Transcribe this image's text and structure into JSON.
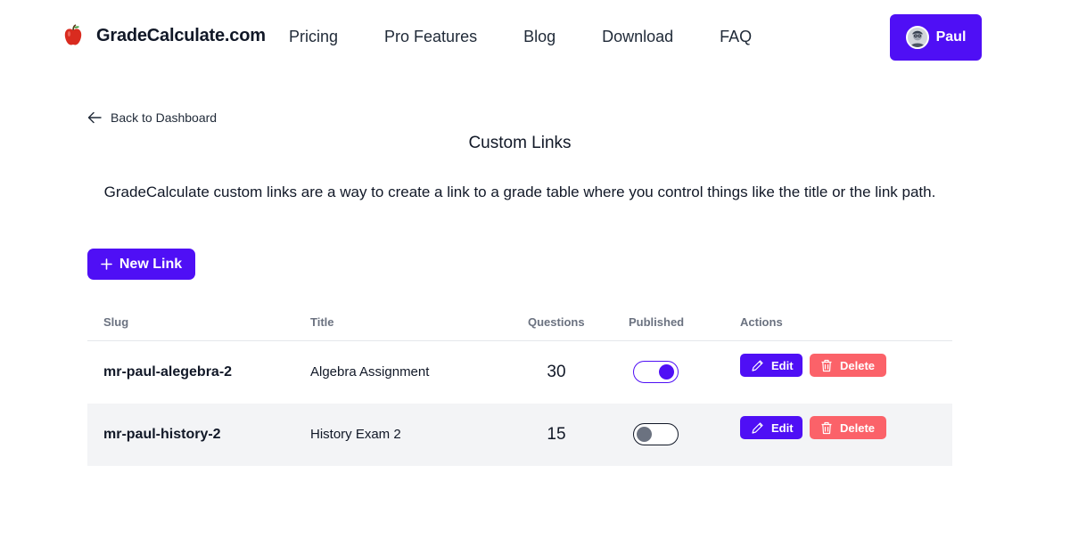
{
  "brand": {
    "name": "GradeCalculate.com",
    "logo_icon": "apple-icon"
  },
  "nav": {
    "items": [
      {
        "label": "Pricing"
      },
      {
        "label": "Pro Features"
      },
      {
        "label": "Blog"
      },
      {
        "label": "Download"
      },
      {
        "label": "FAQ"
      }
    ]
  },
  "user": {
    "name": "Paul"
  },
  "back_link": {
    "label": "Back to Dashboard",
    "icon": "arrow-left-icon"
  },
  "page": {
    "title": "Custom Links",
    "description": "GradeCalculate custom links are a way to create a link to a grade table where you control things like the title or the link path."
  },
  "new_link_button": {
    "label": "New Link",
    "icon": "plus-icon"
  },
  "table": {
    "headers": [
      "Slug",
      "Title",
      "Questions",
      "Published",
      "Actions"
    ],
    "rows": [
      {
        "slug": "mr-paul-alegebra-2",
        "title": "Algebra Assignment",
        "questions": "30",
        "published": true
      },
      {
        "slug": "mr-paul-history-2",
        "title": "History Exam 2",
        "questions": "15",
        "published": false
      }
    ],
    "edit_label": "Edit",
    "delete_label": "Delete"
  },
  "colors": {
    "accent": "#4f0ff5",
    "delete": "#fb6269",
    "row_alt": "#f3f4f6"
  }
}
